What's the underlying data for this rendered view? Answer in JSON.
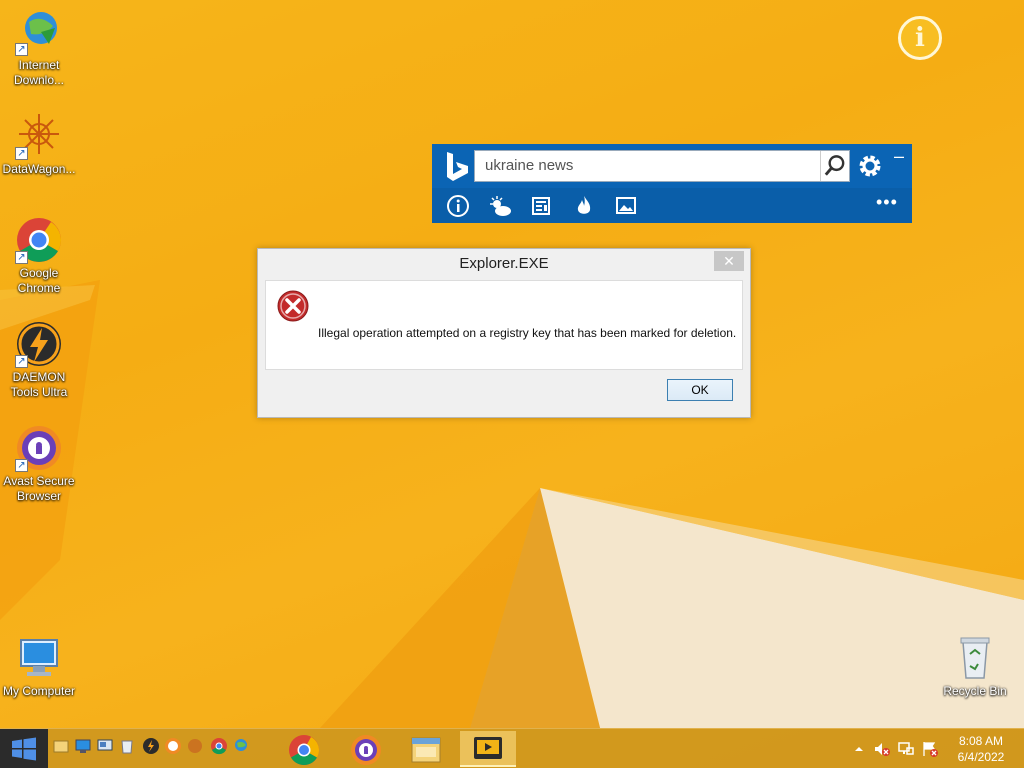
{
  "desktop": {
    "icons": [
      {
        "label": "Internet Downlo...",
        "icon": "idm-globe-icon"
      },
      {
        "label": "DataWagon...",
        "icon": "datawagon-icon"
      },
      {
        "label": "Google Chrome",
        "icon": "chrome-icon"
      },
      {
        "label": "DAEMON Tools Ultra",
        "icon": "daemon-tools-icon"
      },
      {
        "label": "Avast Secure Browser",
        "icon": "avast-browser-icon"
      },
      {
        "label": "My Computer",
        "icon": "computer-icon"
      },
      {
        "label": "Recycle Bin",
        "icon": "recycle-bin-icon"
      }
    ],
    "info_glyph": "i"
  },
  "bing_bar": {
    "search_value": "ukraine news",
    "minimize_glyph": "–",
    "more_glyph": "•••",
    "toolbar_icons": [
      "info-icon",
      "weather-icon",
      "news-icon",
      "trending-icon",
      "images-icon"
    ],
    "brand_color": "#0b64b4"
  },
  "dialog": {
    "title": "Explorer.EXE",
    "close_glyph": "✕",
    "message": "Illegal operation attempted on a registry key that has been marked for deletion.",
    "ok_label": "OK",
    "icon": "error-icon"
  },
  "taskbar": {
    "time": "8:08 AM",
    "date": "6/4/2022",
    "tray_icons": [
      "show-hidden-arrow-icon",
      "volume-muted-icon",
      "network-icon",
      "action-center-icon"
    ]
  }
}
